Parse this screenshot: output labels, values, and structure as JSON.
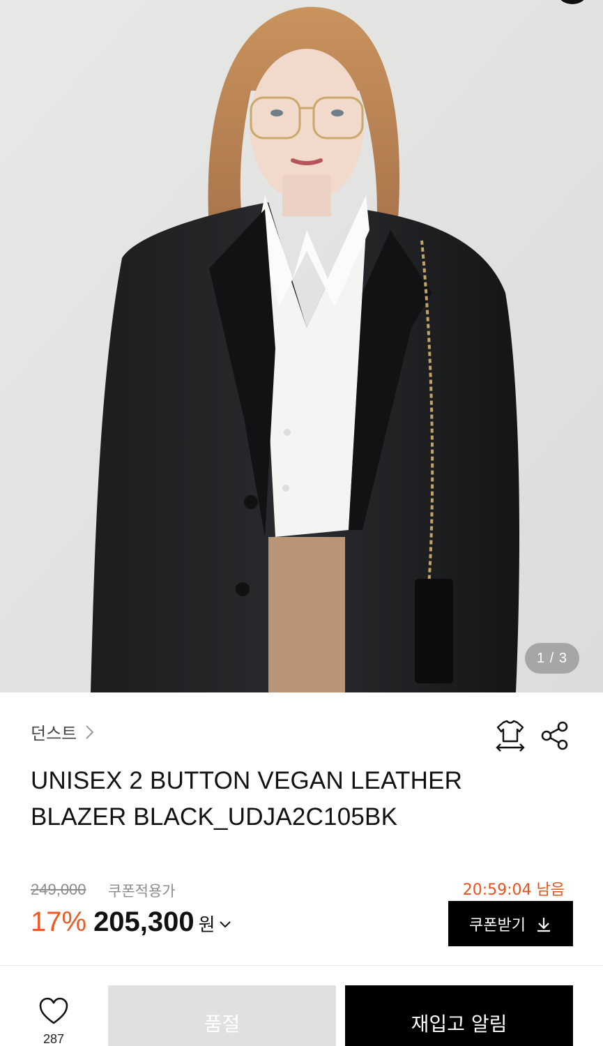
{
  "gallery": {
    "counter": "1 / 3"
  },
  "product": {
    "brand": "던스트",
    "title_line1": "UNISEX 2 BUTTON VEGAN LEATHER",
    "title_line2": "BLAZER BLACK_UDJA2C105BK"
  },
  "price": {
    "original": "249,000",
    "coupon_label": "쿠폰적용가",
    "discount": "17%",
    "sale": "205,300",
    "currency": "원",
    "countdown": "20:59:04 남음"
  },
  "coupon_button": {
    "label": "쿠폰받기"
  },
  "bottom_bar": {
    "like_count": "287",
    "soldout_label": "품절",
    "restock_label": "재입고 알림"
  },
  "colors": {
    "accent": "#ee5a24",
    "countdown": "#e8531d",
    "primary_button": "#000000",
    "disabled_button": "#e0e0e0"
  },
  "icons": [
    "chevron-right-icon",
    "size-guide-icon",
    "share-icon",
    "chevron-down-icon",
    "download-icon",
    "heart-icon"
  ]
}
